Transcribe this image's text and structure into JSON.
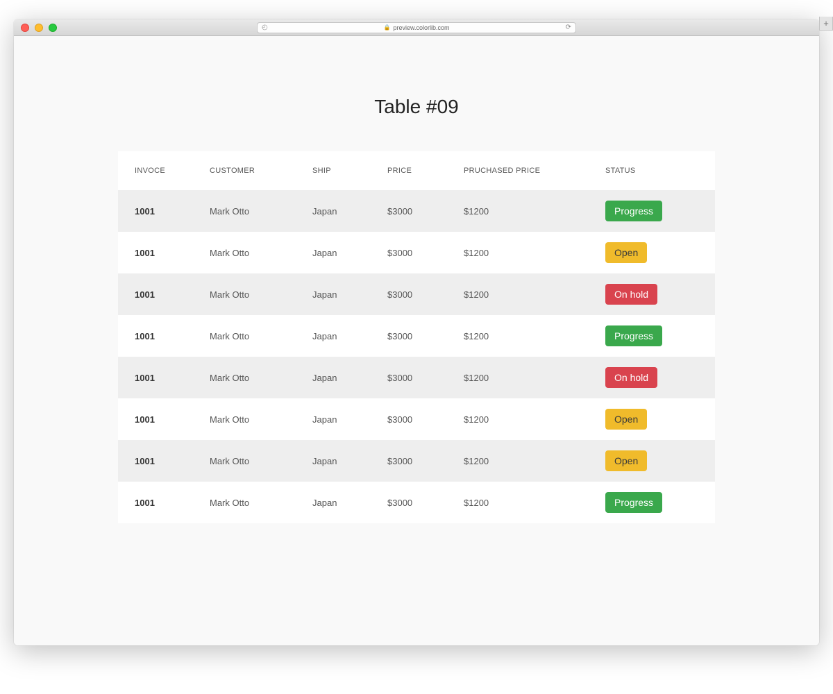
{
  "browser": {
    "url": "preview.colorlib.com"
  },
  "page": {
    "title": "Table #09"
  },
  "table": {
    "headers": {
      "invoice": "INVOCE",
      "customer": "CUSTOMER",
      "ship": "SHIP",
      "price": "PRICE",
      "purchased": "PRUCHASED PRICE",
      "status": "STATUS"
    },
    "rows": [
      {
        "invoice": "1001",
        "customer": "Mark Otto",
        "ship": "Japan",
        "price": "$3000",
        "purchased": "$1200",
        "status": "Progress",
        "status_type": "progress"
      },
      {
        "invoice": "1001",
        "customer": "Mark Otto",
        "ship": "Japan",
        "price": "$3000",
        "purchased": "$1200",
        "status": "Open",
        "status_type": "open"
      },
      {
        "invoice": "1001",
        "customer": "Mark Otto",
        "ship": "Japan",
        "price": "$3000",
        "purchased": "$1200",
        "status": "On hold",
        "status_type": "onhold"
      },
      {
        "invoice": "1001",
        "customer": "Mark Otto",
        "ship": "Japan",
        "price": "$3000",
        "purchased": "$1200",
        "status": "Progress",
        "status_type": "progress"
      },
      {
        "invoice": "1001",
        "customer": "Mark Otto",
        "ship": "Japan",
        "price": "$3000",
        "purchased": "$1200",
        "status": "On hold",
        "status_type": "onhold"
      },
      {
        "invoice": "1001",
        "customer": "Mark Otto",
        "ship": "Japan",
        "price": "$3000",
        "purchased": "$1200",
        "status": "Open",
        "status_type": "open"
      },
      {
        "invoice": "1001",
        "customer": "Mark Otto",
        "ship": "Japan",
        "price": "$3000",
        "purchased": "$1200",
        "status": "Open",
        "status_type": "open"
      },
      {
        "invoice": "1001",
        "customer": "Mark Otto",
        "ship": "Japan",
        "price": "$3000",
        "purchased": "$1200",
        "status": "Progress",
        "status_type": "progress"
      }
    ]
  },
  "status_colors": {
    "progress": "#3aa84c",
    "open": "#f0bb2b",
    "onhold": "#d9434e"
  }
}
